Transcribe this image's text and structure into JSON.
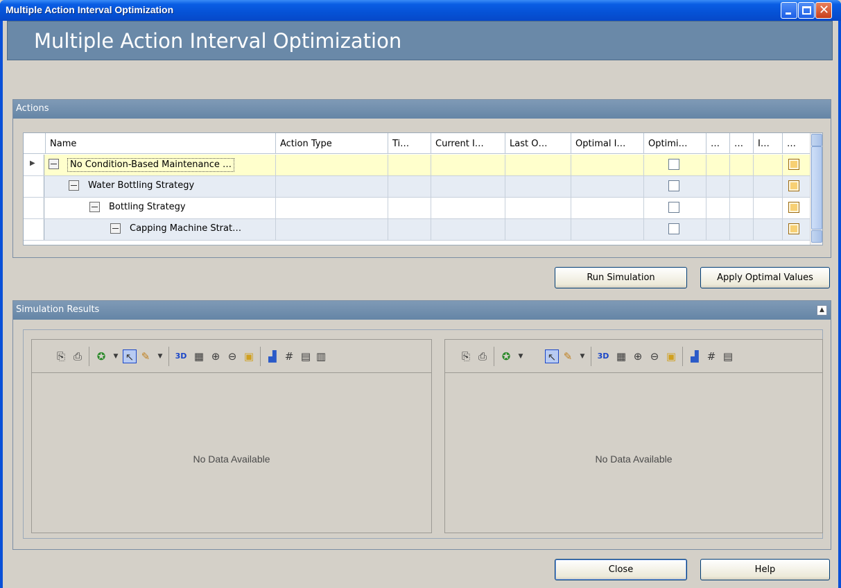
{
  "window": {
    "title": "Multiple Action Interval Optimization"
  },
  "header": {
    "title": "Multiple Action Interval Optimization"
  },
  "actions_panel": {
    "label": "Actions",
    "columns": [
      "Name",
      "Action Type",
      "Ti…",
      "Current I…",
      "Last O…",
      "Optimal I…",
      "Optimi…",
      "…",
      "…",
      "I…",
      "…"
    ],
    "rows": [
      {
        "name": "No Condition-Based Maintenance …",
        "level": 0
      },
      {
        "name": "Water Bottling Strategy",
        "level": 1
      },
      {
        "name": "Bottling Strategy",
        "level": 2
      },
      {
        "name": "Capping Machine Strat…",
        "level": 3
      }
    ]
  },
  "buttons": {
    "run_simulation": "Run Simulation",
    "apply_optimal": "Apply Optimal Values",
    "close": "Close",
    "help": "Help"
  },
  "results_panel": {
    "label": "Simulation Results",
    "left_message": "No Data Available",
    "right_message": "No Data Available"
  },
  "colors": {
    "title_bar": "#0552d6",
    "banner": "#6a89a8",
    "panel_header": "#6585a6",
    "selected_row": "#ffffcc",
    "alt_row": "#e6ecf4"
  }
}
